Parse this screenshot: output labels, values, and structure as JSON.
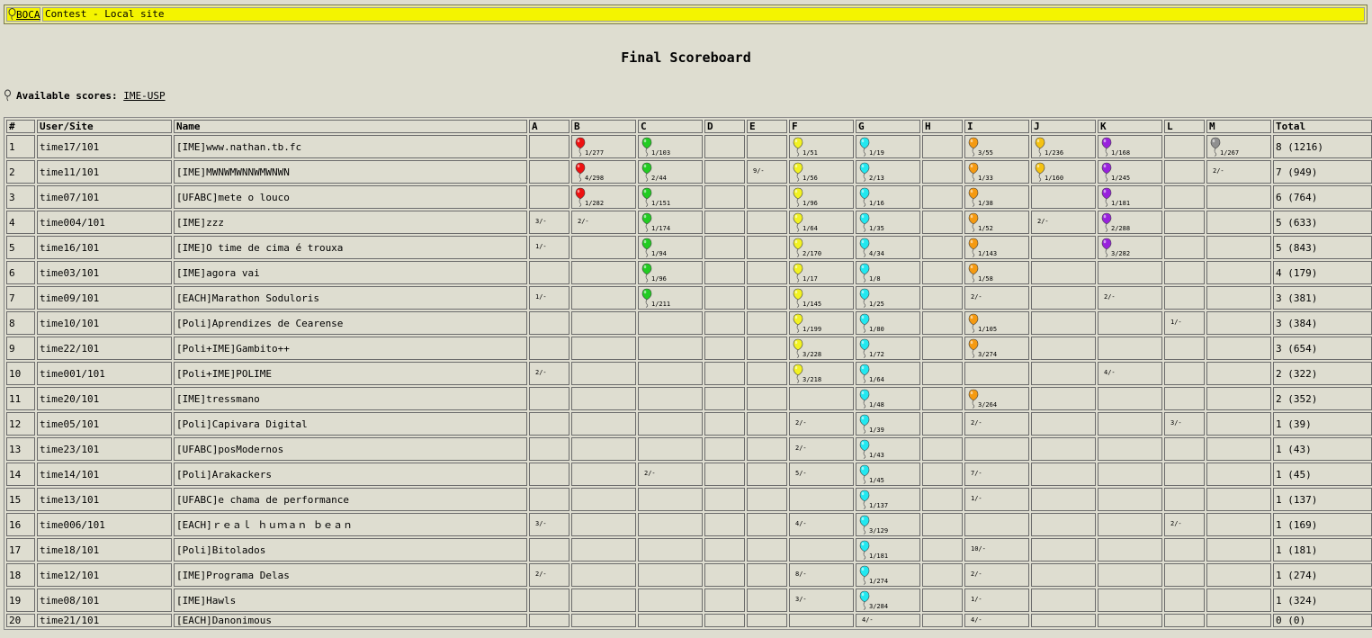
{
  "header": {
    "logo_label": "BOCA",
    "contest_label": "Contest - Local site"
  },
  "page_title": "Final Scoreboard",
  "available_scores": {
    "label": "Available scores:",
    "link": "IME-USP"
  },
  "colors": {
    "A": "#888888",
    "B": "#ee1111",
    "C": "#22cc22",
    "D": "#888888",
    "E": "#888888",
    "F": "#f2f222",
    "G": "#22e8f0",
    "H": "#888888",
    "I": "#f59a11",
    "J": "#f5c211",
    "K": "#9922dd",
    "L": "#888888",
    "M": "#909090"
  },
  "columns": {
    "rank": "#",
    "user": "User/Site",
    "name": "Name",
    "problems": [
      "A",
      "B",
      "C",
      "D",
      "E",
      "F",
      "G",
      "H",
      "I",
      "J",
      "K",
      "L",
      "M"
    ],
    "total": "Total"
  },
  "rows": [
    {
      "rank": "1",
      "user": "time17/101",
      "name": "[IME]www.nathan.tb.fc",
      "cells": {
        "B": {
          "s": 1,
          "t": "1/277"
        },
        "C": {
          "s": 1,
          "t": "1/103"
        },
        "F": {
          "s": 1,
          "t": "1/51"
        },
        "G": {
          "s": 1,
          "t": "1/19"
        },
        "I": {
          "s": 1,
          "t": "3/55"
        },
        "J": {
          "s": 1,
          "t": "1/236"
        },
        "K": {
          "s": 1,
          "t": "1/168"
        },
        "M": {
          "s": 1,
          "t": "1/267"
        }
      },
      "total": "8 (1216)"
    },
    {
      "rank": "2",
      "user": "time11/101",
      "name": "[IME]MWNWMWNNWMWNWN",
      "cells": {
        "B": {
          "s": 1,
          "t": "4/298"
        },
        "C": {
          "s": 1,
          "t": "2/44"
        },
        "E": {
          "s": 0,
          "t": "9/-"
        },
        "F": {
          "s": 1,
          "t": "1/56"
        },
        "G": {
          "s": 1,
          "t": "2/13"
        },
        "I": {
          "s": 1,
          "t": "1/33"
        },
        "J": {
          "s": 1,
          "t": "1/160"
        },
        "K": {
          "s": 1,
          "t": "1/245"
        },
        "M": {
          "s": 0,
          "t": "2/-"
        }
      },
      "total": "7 (949)"
    },
    {
      "rank": "3",
      "user": "time07/101",
      "name": "[UFABC]mete o louco",
      "cells": {
        "B": {
          "s": 1,
          "t": "1/282"
        },
        "C": {
          "s": 1,
          "t": "1/151"
        },
        "F": {
          "s": 1,
          "t": "1/96"
        },
        "G": {
          "s": 1,
          "t": "1/16"
        },
        "I": {
          "s": 1,
          "t": "1/38"
        },
        "K": {
          "s": 1,
          "t": "1/181"
        }
      },
      "total": "6 (764)"
    },
    {
      "rank": "4",
      "user": "time004/101",
      "name": "[IME]zzz",
      "cells": {
        "A": {
          "s": 0,
          "t": "3/-"
        },
        "B": {
          "s": 0,
          "t": "2/-"
        },
        "C": {
          "s": 1,
          "t": "1/174"
        },
        "F": {
          "s": 1,
          "t": "1/64"
        },
        "G": {
          "s": 1,
          "t": "1/35"
        },
        "I": {
          "s": 1,
          "t": "1/52"
        },
        "J": {
          "s": 0,
          "t": "2/-"
        },
        "K": {
          "s": 1,
          "t": "2/288"
        }
      },
      "total": "5 (633)"
    },
    {
      "rank": "5",
      "user": "time16/101",
      "name": "[IME]O time de cima é trouxa",
      "cells": {
        "A": {
          "s": 0,
          "t": "1/-"
        },
        "C": {
          "s": 1,
          "t": "1/94"
        },
        "F": {
          "s": 1,
          "t": "2/170"
        },
        "G": {
          "s": 1,
          "t": "4/34"
        },
        "I": {
          "s": 1,
          "t": "1/143"
        },
        "K": {
          "s": 1,
          "t": "3/282"
        }
      },
      "total": "5 (843)"
    },
    {
      "rank": "6",
      "user": "time03/101",
      "name": "[IME]agora vai",
      "cells": {
        "C": {
          "s": 1,
          "t": "1/96"
        },
        "F": {
          "s": 1,
          "t": "1/17"
        },
        "G": {
          "s": 1,
          "t": "1/8"
        },
        "I": {
          "s": 1,
          "t": "1/58"
        }
      },
      "total": "4 (179)"
    },
    {
      "rank": "7",
      "user": "time09/101",
      "name": "[EACH]Marathon Soduloris",
      "cells": {
        "A": {
          "s": 0,
          "t": "1/-"
        },
        "C": {
          "s": 1,
          "t": "1/211"
        },
        "F": {
          "s": 1,
          "t": "1/145"
        },
        "G": {
          "s": 1,
          "t": "1/25"
        },
        "I": {
          "s": 0,
          "t": "2/-"
        },
        "K": {
          "s": 0,
          "t": "2/-"
        }
      },
      "total": "3 (381)"
    },
    {
      "rank": "8",
      "user": "time10/101",
      "name": "[Poli]Aprendizes de Cearense",
      "cells": {
        "F": {
          "s": 1,
          "t": "1/199"
        },
        "G": {
          "s": 1,
          "t": "1/80"
        },
        "I": {
          "s": 1,
          "t": "1/105"
        },
        "L": {
          "s": 0,
          "t": "1/-"
        }
      },
      "total": "3 (384)"
    },
    {
      "rank": "9",
      "user": "time22/101",
      "name": "[Poli+IME]Gambito++",
      "cells": {
        "F": {
          "s": 1,
          "t": "3/228"
        },
        "G": {
          "s": 1,
          "t": "1/72"
        },
        "I": {
          "s": 1,
          "t": "3/274"
        }
      },
      "total": "3 (654)"
    },
    {
      "rank": "10",
      "user": "time001/101",
      "name": "[Poli+IME]POLIME",
      "cells": {
        "A": {
          "s": 0,
          "t": "2/-"
        },
        "F": {
          "s": 1,
          "t": "3/218"
        },
        "G": {
          "s": 1,
          "t": "1/64"
        },
        "K": {
          "s": 0,
          "t": "4/-"
        }
      },
      "total": "2 (322)"
    },
    {
      "rank": "11",
      "user": "time20/101",
      "name": "[IME]tressmano",
      "cells": {
        "G": {
          "s": 1,
          "t": "1/48"
        },
        "I": {
          "s": 1,
          "t": "3/264"
        }
      },
      "total": "2 (352)"
    },
    {
      "rank": "12",
      "user": "time05/101",
      "name": "[Poli]Capivara Digital",
      "cells": {
        "F": {
          "s": 0,
          "t": "2/-"
        },
        "G": {
          "s": 1,
          "t": "1/39"
        },
        "I": {
          "s": 0,
          "t": "2/-"
        },
        "L": {
          "s": 0,
          "t": "3/-"
        }
      },
      "total": "1 (39)"
    },
    {
      "rank": "13",
      "user": "time23/101",
      "name": "[UFABC]posModernos",
      "cells": {
        "F": {
          "s": 0,
          "t": "2/-"
        },
        "G": {
          "s": 1,
          "t": "1/43"
        }
      },
      "total": "1 (43)"
    },
    {
      "rank": "14",
      "user": "time14/101",
      "name": "[Poli]Arakackers",
      "cells": {
        "C": {
          "s": 0,
          "t": "2/-"
        },
        "F": {
          "s": 0,
          "t": "5/-"
        },
        "G": {
          "s": 1,
          "t": "1/45"
        },
        "I": {
          "s": 0,
          "t": "7/-"
        }
      },
      "total": "1 (45)"
    },
    {
      "rank": "15",
      "user": "time13/101",
      "name": "[UFABC]e chama de performance",
      "cells": {
        "G": {
          "s": 1,
          "t": "1/137"
        },
        "I": {
          "s": 0,
          "t": "1/-"
        }
      },
      "total": "1 (137)"
    },
    {
      "rank": "16",
      "user": "time006/101",
      "name": "[EACH]ｒｅａｌ ｈｕｍａｎ ｂｅａｎ",
      "cells": {
        "A": {
          "s": 0,
          "t": "3/-"
        },
        "F": {
          "s": 0,
          "t": "4/-"
        },
        "G": {
          "s": 1,
          "t": "3/129"
        },
        "L": {
          "s": 0,
          "t": "2/-"
        }
      },
      "total": "1 (169)"
    },
    {
      "rank": "17",
      "user": "time18/101",
      "name": "[Poli]Bitolados",
      "cells": {
        "G": {
          "s": 1,
          "t": "1/181"
        },
        "I": {
          "s": 0,
          "t": "10/-"
        }
      },
      "total": "1 (181)"
    },
    {
      "rank": "18",
      "user": "time12/101",
      "name": "[IME]Programa Delas",
      "cells": {
        "A": {
          "s": 0,
          "t": "2/-"
        },
        "F": {
          "s": 0,
          "t": "8/-"
        },
        "G": {
          "s": 1,
          "t": "1/274"
        },
        "I": {
          "s": 0,
          "t": "2/-"
        }
      },
      "total": "1 (274)"
    },
    {
      "rank": "19",
      "user": "time08/101",
      "name": "[IME]Hawls",
      "cells": {
        "F": {
          "s": 0,
          "t": "3/-"
        },
        "G": {
          "s": 1,
          "t": "3/284"
        },
        "I": {
          "s": 0,
          "t": "1/-"
        }
      },
      "total": "1 (324)"
    },
    {
      "rank": "20",
      "user": "time21/101",
      "name": "[EACH]Danonimous",
      "cells": {
        "G": {
          "s": 0,
          "t": "4/-"
        },
        "I": {
          "s": 0,
          "t": "4/-"
        }
      },
      "total": "0 (0)"
    }
  ]
}
